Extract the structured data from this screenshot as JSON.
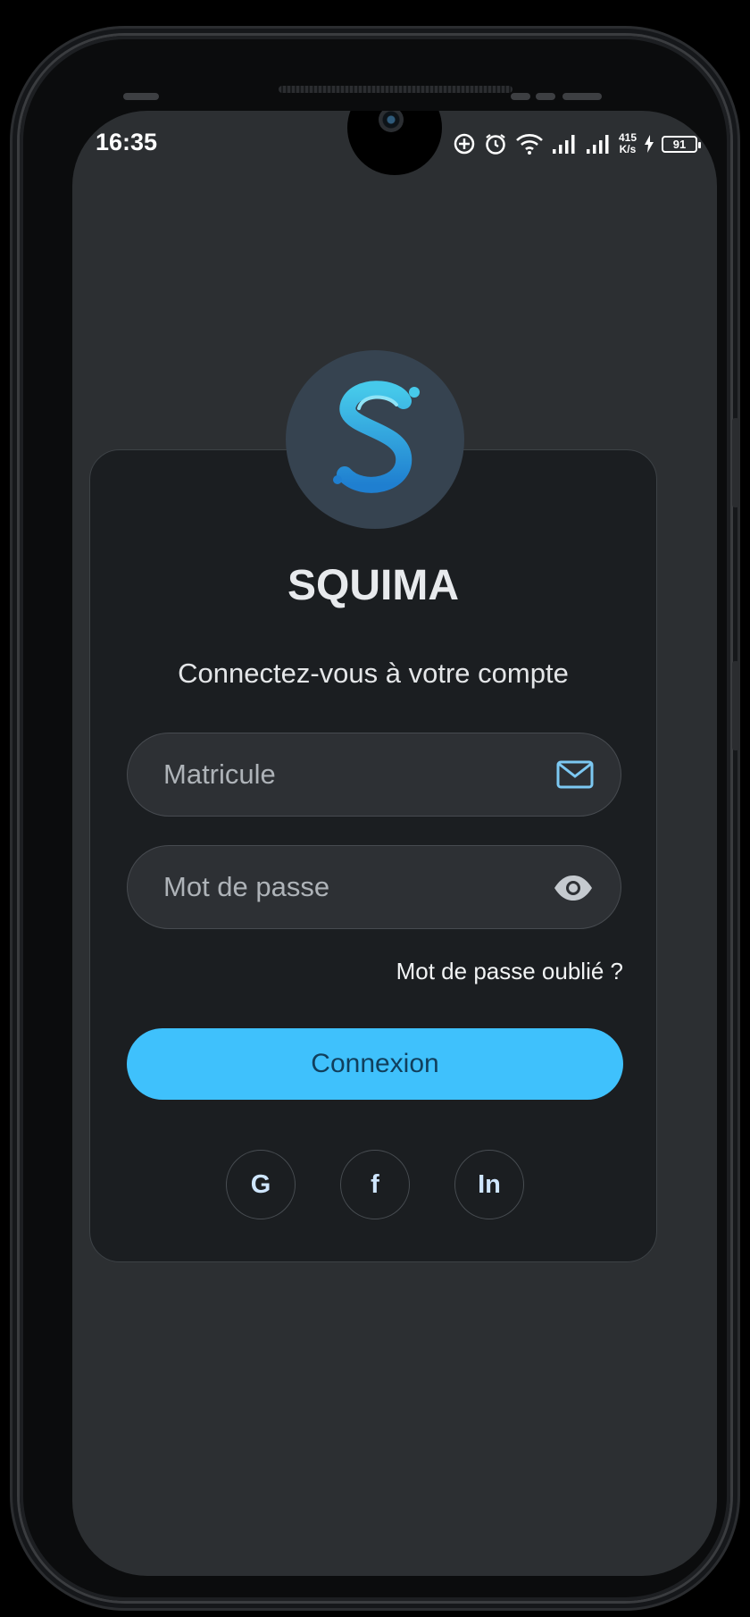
{
  "status_bar": {
    "time": "16:35",
    "speed_value": "415",
    "speed_unit": "K/s",
    "battery": "91"
  },
  "app": {
    "name": "SQUIMA",
    "subtitle": "Connectez-vous à votre compte"
  },
  "form": {
    "matricule_placeholder": "Matricule",
    "password_placeholder": "Mot de passe",
    "forgot_label": "Mot de passe oublié ?",
    "submit_label": "Connexion"
  },
  "social": {
    "google_label": "G",
    "facebook_label": "f",
    "linkedin_label": "In"
  },
  "colors": {
    "accent": "#3fc1fc",
    "card": "#1b1e21",
    "background": "#2c2f32"
  },
  "icons": [
    "add-circle-icon",
    "alarm-icon",
    "wifi-icon",
    "signal-icon",
    "charging-icon",
    "battery-icon",
    "mail-icon",
    "eye-icon"
  ]
}
